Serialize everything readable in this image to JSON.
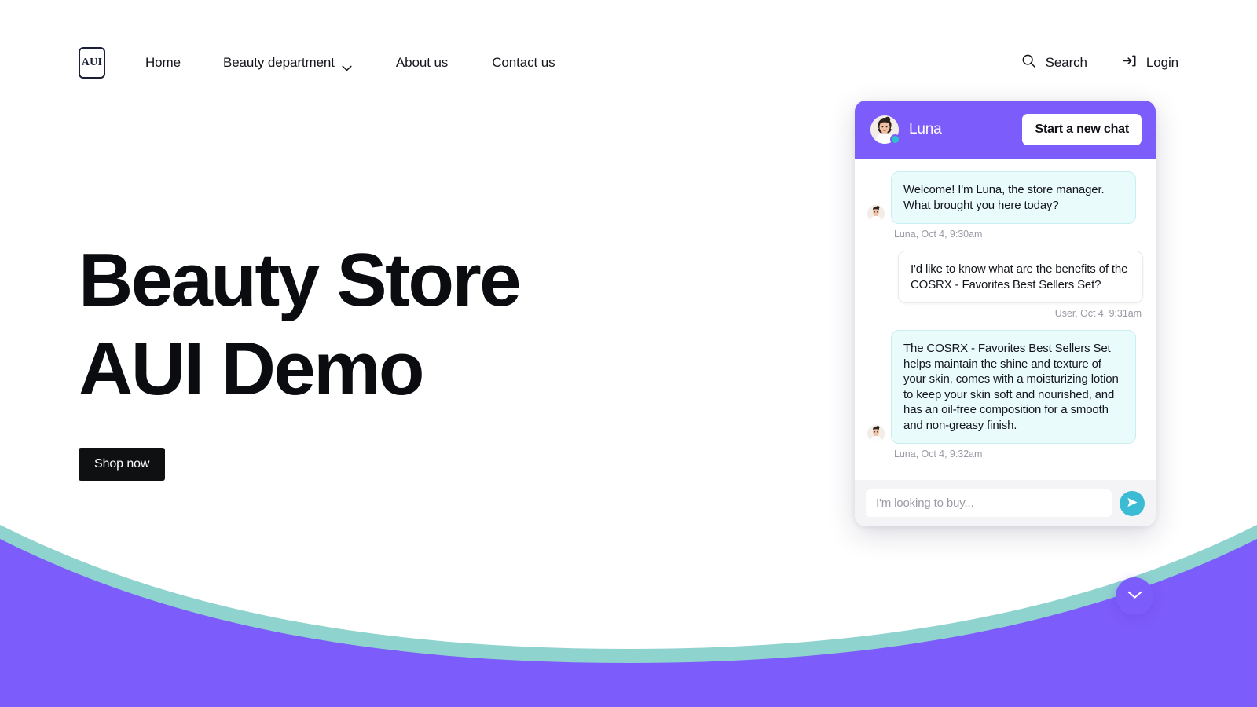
{
  "brand": {
    "logo_text": "AUI"
  },
  "nav": {
    "items": [
      {
        "label": "Home",
        "has_caret": false
      },
      {
        "label": "Beauty department",
        "has_caret": true
      },
      {
        "label": "About us",
        "has_caret": false
      },
      {
        "label": "Contact us",
        "has_caret": false
      }
    ],
    "search_label": "Search",
    "login_label": "Login"
  },
  "hero": {
    "title": "Beauty Store\nAUI Demo",
    "cta_label": "Shop now"
  },
  "chat": {
    "agent_name": "Luna",
    "new_chat_label": "Start a new chat",
    "messages": [
      {
        "sender": "bot",
        "text": "Welcome! I'm Luna, the store manager. What brought you here today?",
        "stamp": "Luna, Oct 4, 9:30am"
      },
      {
        "sender": "user",
        "text": "I'd like to know what are the benefits of the COSRX - Favorites Best Sellers Set?",
        "stamp": "User, Oct 4, 9:31am"
      },
      {
        "sender": "bot",
        "text": "The COSRX - Favorites Best Sellers Set helps maintain the shine and texture of your skin, comes with a moisturizing lotion to keep your skin soft and nourished, and has an oil-free composition for a smooth and non-greasy finish.",
        "stamp": "Luna, Oct 4, 9:32am"
      }
    ],
    "input_placeholder": "I'm looking to buy...",
    "input_value": ""
  },
  "colors": {
    "purple": "#7c5cfa",
    "teal": "#3cbcd4",
    "wave_teal": "#8fd3cf",
    "bot_bubble": "#e9fbfb",
    "dark": "#0f1011"
  }
}
